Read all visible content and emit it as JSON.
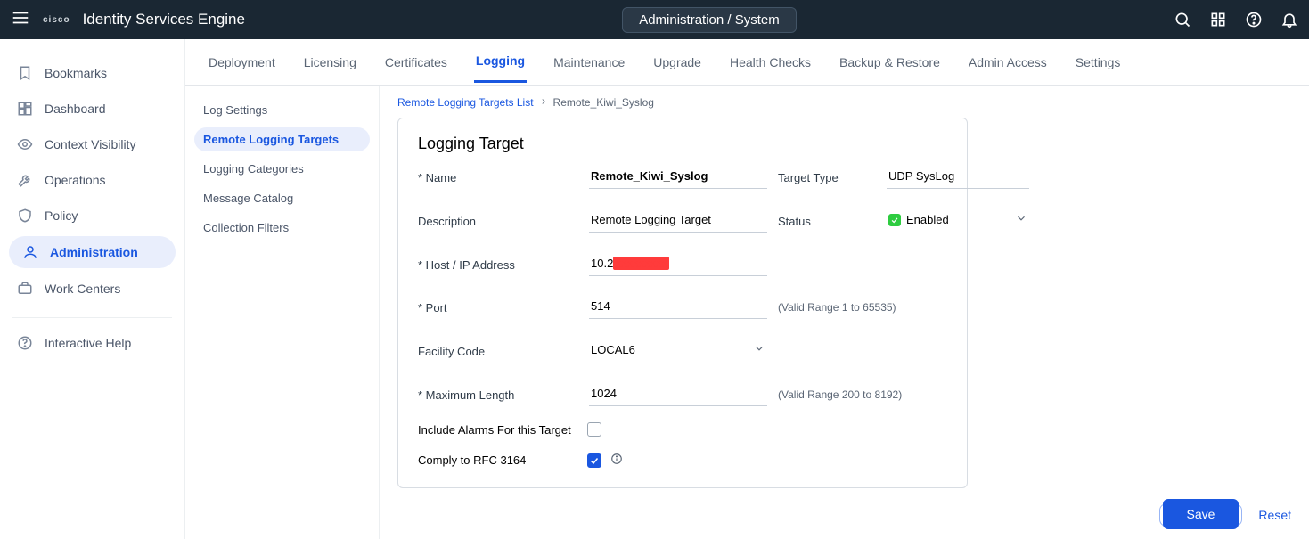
{
  "header": {
    "brand": "Identity Services Engine",
    "logo_text": "cisco",
    "page_crumb": "Administration / System"
  },
  "sidebar": {
    "items": [
      {
        "label": "Bookmarks"
      },
      {
        "label": "Dashboard"
      },
      {
        "label": "Context Visibility"
      },
      {
        "label": "Operations"
      },
      {
        "label": "Policy"
      },
      {
        "label": "Administration"
      },
      {
        "label": "Work Centers"
      }
    ],
    "help_label": "Interactive Help"
  },
  "tabs": [
    {
      "label": "Deployment"
    },
    {
      "label": "Licensing"
    },
    {
      "label": "Certificates"
    },
    {
      "label": "Logging",
      "active": true
    },
    {
      "label": "Maintenance"
    },
    {
      "label": "Upgrade"
    },
    {
      "label": "Health Checks"
    },
    {
      "label": "Backup & Restore"
    },
    {
      "label": "Admin Access"
    },
    {
      "label": "Settings"
    }
  ],
  "subnav": [
    {
      "label": "Log Settings"
    },
    {
      "label": "Remote Logging Targets",
      "active": true
    },
    {
      "label": "Logging Categories"
    },
    {
      "label": "Message Catalog"
    },
    {
      "label": "Collection Filters"
    }
  ],
  "breadcrumb": {
    "link_label": "Remote Logging Targets List",
    "current_label": "Remote_Kiwi_Syslog"
  },
  "panel": {
    "title": "Logging Target",
    "labels": {
      "name": "* Name",
      "description": "Description",
      "host": "* Host / IP Address",
      "port": "* Port",
      "facility": "Facility Code",
      "max_len": "* Maximum Length",
      "target_type": "Target Type",
      "status": "Status",
      "include_alarms": "Include Alarms For this Target",
      "comply_rfc": "Comply to RFC 3164"
    },
    "values": {
      "name": "Remote_Kiwi_Syslog",
      "description": "Remote Logging Target",
      "host_prefix": "10.2",
      "port": "514",
      "facility": "LOCAL6",
      "max_len": "1024",
      "target_type": "UDP SysLog",
      "status": "Enabled"
    },
    "hints": {
      "port": "(Valid Range 1 to 65535)",
      "max_len": "(Valid Range 200 to 8192)"
    }
  },
  "actions": {
    "save": "Save",
    "reset": "Reset"
  }
}
